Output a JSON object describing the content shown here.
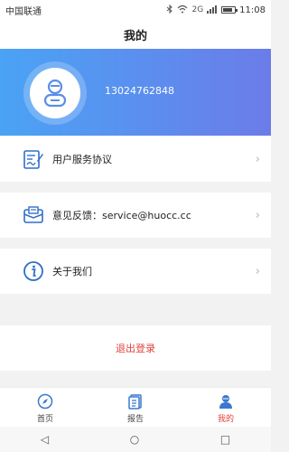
{
  "status_bar": {
    "carrier": "中国联通",
    "network": "2G",
    "time": "11:08"
  },
  "header": {
    "title": "我的"
  },
  "profile": {
    "phone": "13024762848"
  },
  "menu": [
    {
      "label": "用户服务协议",
      "icon": "document-edit-icon"
    },
    {
      "label": "意见反馈：service@huocc.cc",
      "icon": "feedback-mail-icon"
    },
    {
      "label": "关于我们",
      "icon": "info-icon"
    }
  ],
  "logout": {
    "label": "退出登录"
  },
  "tabs": [
    {
      "label": "首页",
      "icon": "compass-icon",
      "active": false
    },
    {
      "label": "报告",
      "icon": "report-icon",
      "active": false
    },
    {
      "label": "我的",
      "icon": "user-icon",
      "active": true
    }
  ],
  "colors": {
    "accent": "#2f8de4",
    "danger": "#e0423c",
    "hero_from": "#4aa3f5",
    "hero_to": "#6b7ce9"
  }
}
